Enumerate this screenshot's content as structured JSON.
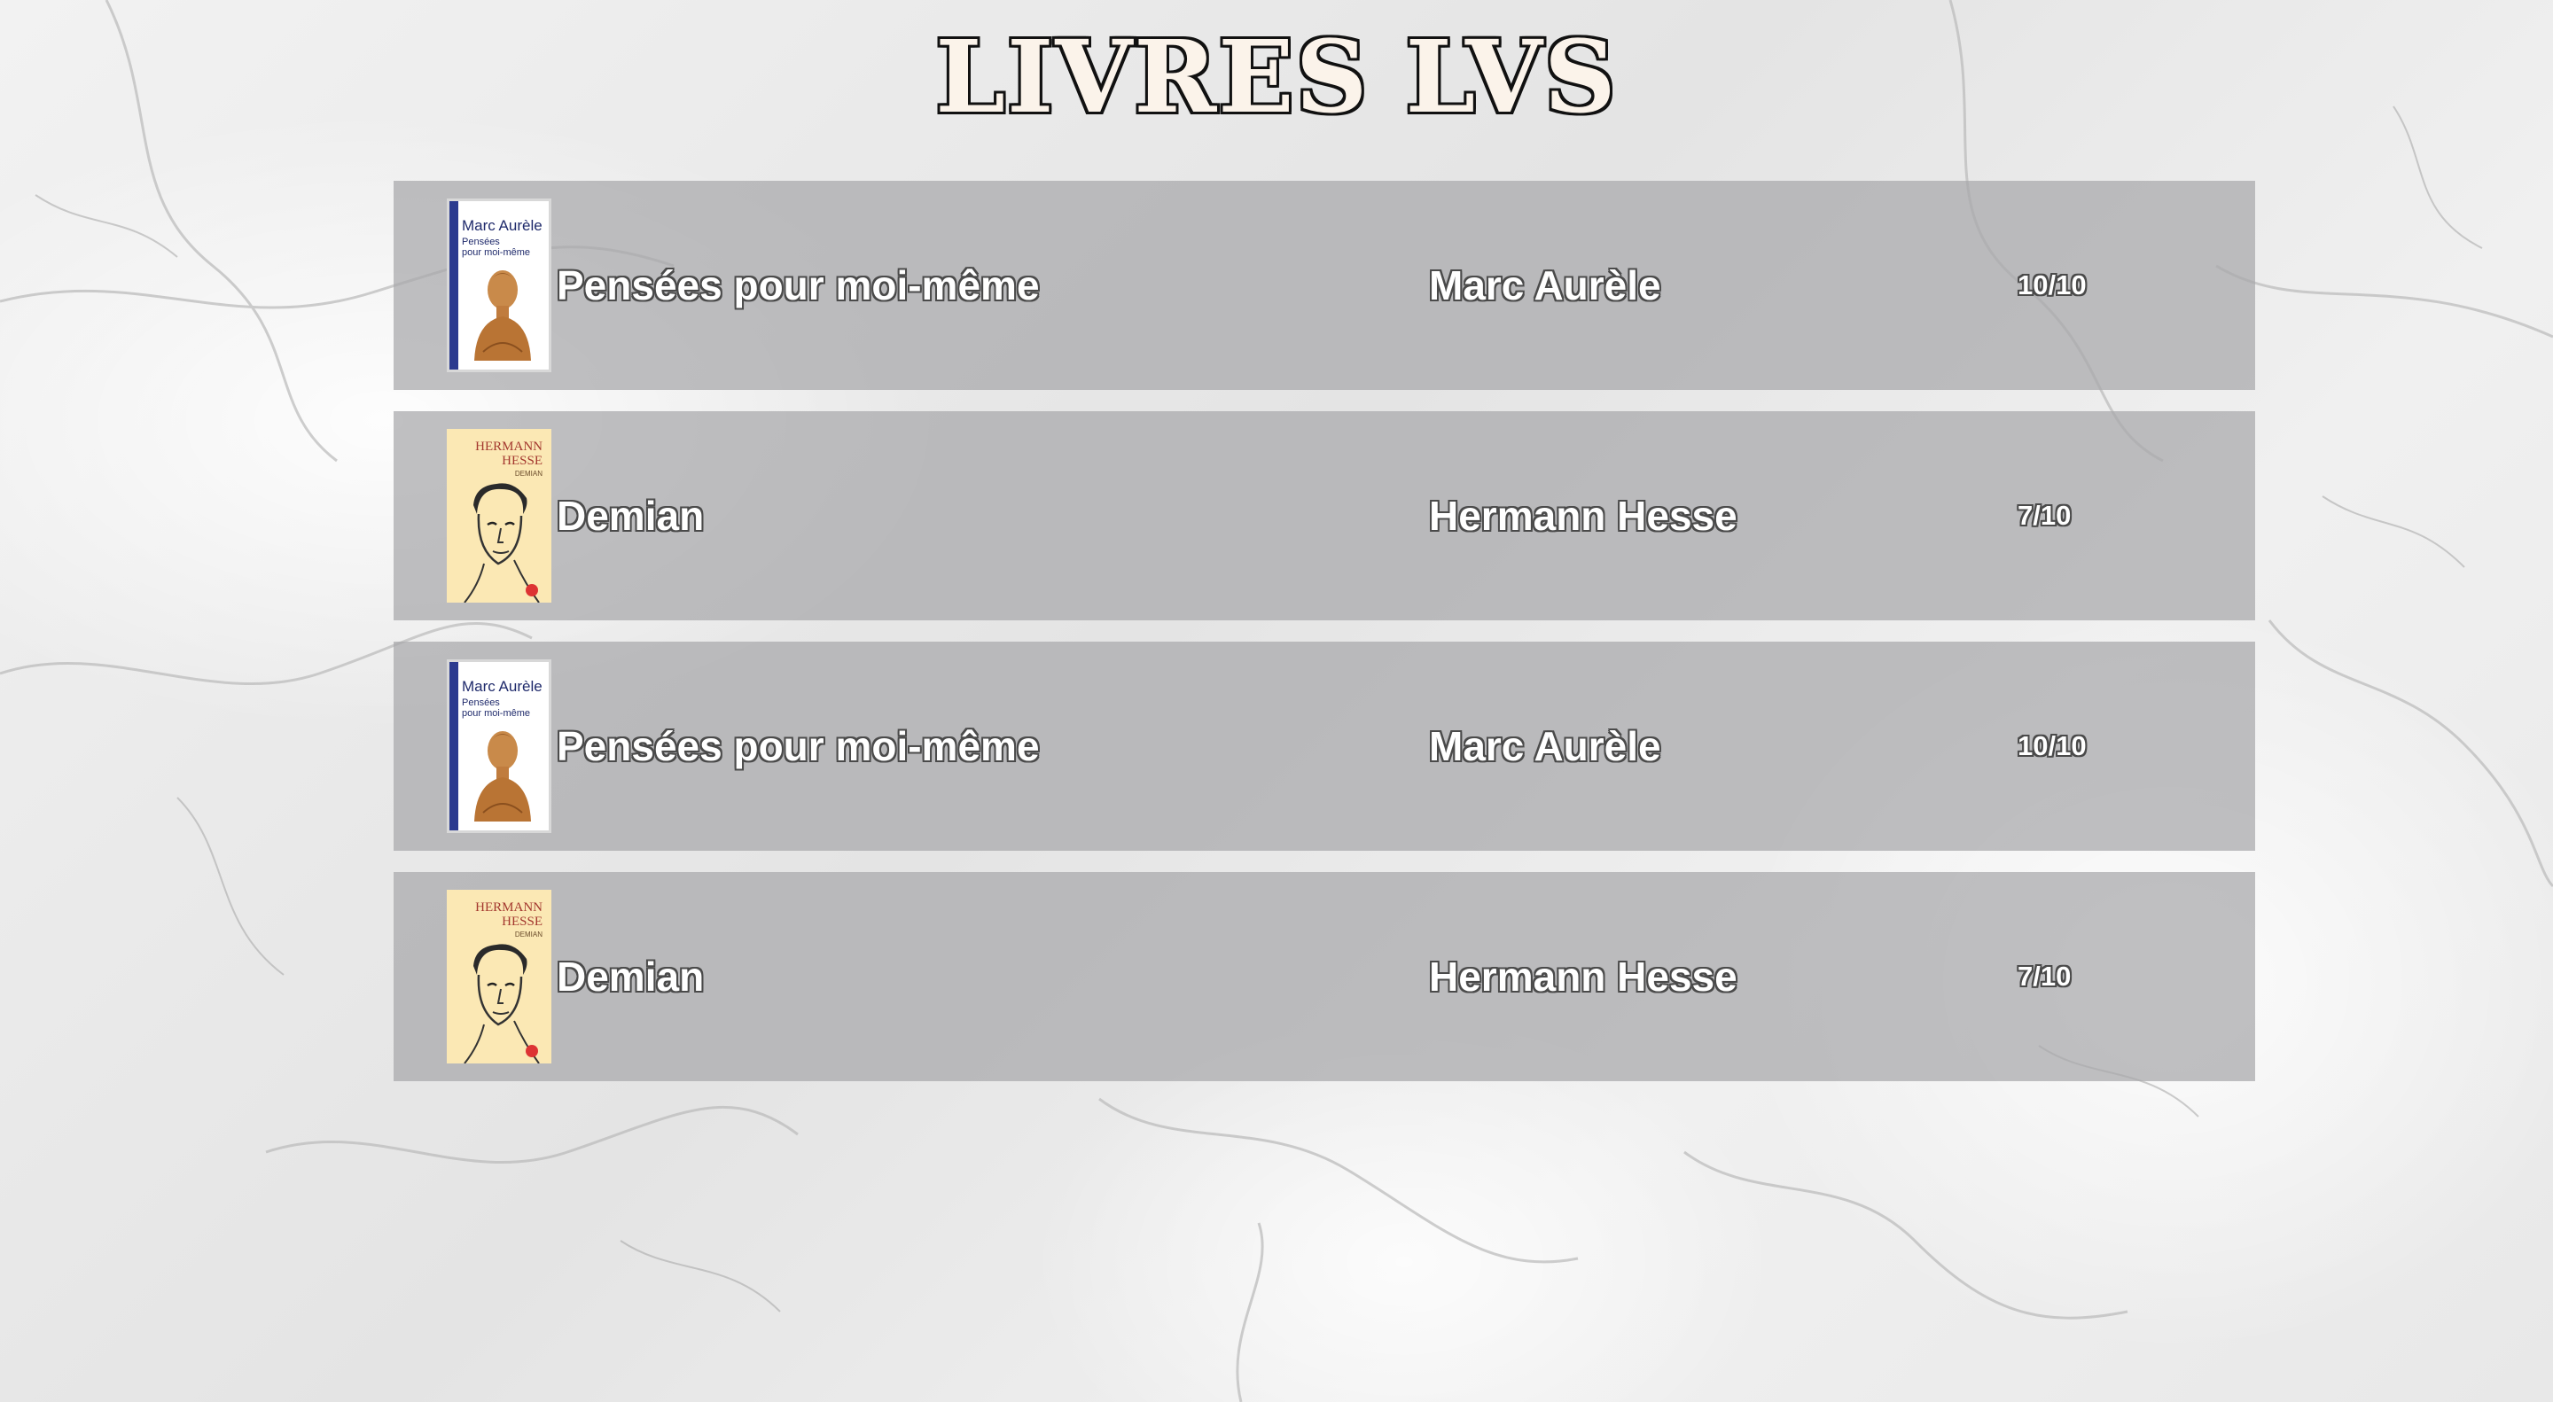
{
  "header": {
    "title": "LIVRES LVS"
  },
  "books": [
    {
      "title": "Pensées pour moi-même",
      "author": "Marc Aurèle",
      "rating": "10/10",
      "cover": "aurele"
    },
    {
      "title": "Demian",
      "author": "Hermann Hesse",
      "rating": "7/10",
      "cover": "hesse"
    },
    {
      "title": "Pensées pour moi-même",
      "author": "Marc Aurèle",
      "rating": "10/10",
      "cover": "aurele"
    },
    {
      "title": "Demian",
      "author": "Hermann Hesse",
      "rating": "7/10",
      "cover": "hesse"
    }
  ],
  "covers": {
    "aurele": {
      "title": "Marc Aurèle",
      "subtitle_line1": "Pensées",
      "subtitle_line2": "pour moi-même"
    },
    "hesse": {
      "author_line1": "HERMANN",
      "author_line2": "HESSE",
      "name": "DEMIAN"
    }
  },
  "colors": {
    "row_background": "#a8a8aa",
    "title_fill": "#fbf3ea",
    "title_outline": "#111111",
    "aurele_cover_accent": "#2c3b8f",
    "hesse_cover_background": "#fbe8b4"
  },
  "icons": {
    "aurele_cover": "bust-illustration",
    "hesse_cover": "portrait-sketch"
  }
}
